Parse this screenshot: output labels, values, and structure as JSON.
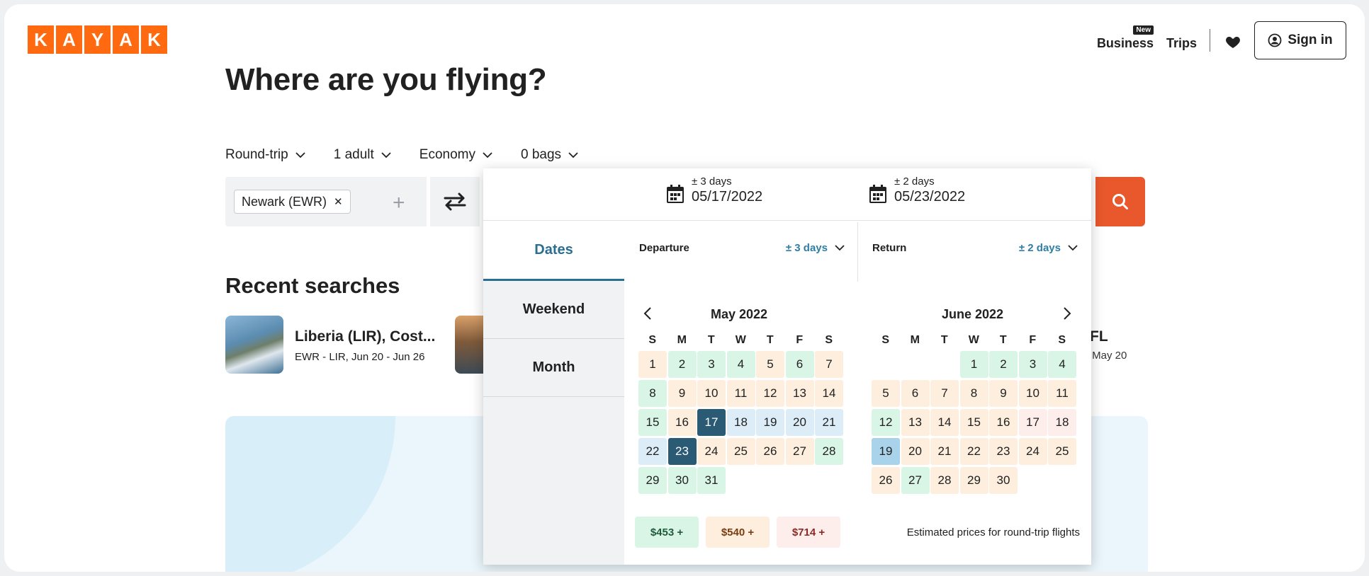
{
  "header": {
    "logo_letters": [
      "K",
      "A",
      "Y",
      "A",
      "K"
    ],
    "business": "Business",
    "new_badge": "New",
    "trips": "Trips",
    "signin": "Sign in"
  },
  "title": "Where are you flying?",
  "options": [
    "Round-trip",
    "1 adult",
    "Economy",
    "0 bags"
  ],
  "origin_chip": "Newark (EWR)",
  "origin_remove": "✕",
  "plus": "+",
  "recent": {
    "heading": "Recent searches",
    "item1_title": "Liberia (LIR), Cost...",
    "item1_sub": "EWR - LIR, Jun 20 - Jun 26",
    "item3_title": "FL",
    "item3_sub": "- May 20"
  },
  "picker": {
    "depart_flex": "± 3 days",
    "depart_date": "05/17/2022",
    "return_flex": "± 2 days",
    "return_date": "05/23/2022",
    "tabs": [
      "Dates",
      "Weekend",
      "Month"
    ],
    "departure_label": "Departure",
    "departure_flex": "± 3 days",
    "return_label": "Return",
    "return_flex2": "± 2 days",
    "dow": [
      "S",
      "M",
      "T",
      "W",
      "T",
      "F",
      "S"
    ],
    "may_title": "May 2022",
    "june_title": "June 2022",
    "may_days": [
      [
        "1",
        "o"
      ],
      [
        "2",
        "g"
      ],
      [
        "3",
        "g"
      ],
      [
        "4",
        "g"
      ],
      [
        "5",
        "o"
      ],
      [
        "6",
        "g"
      ],
      [
        "7",
        "o"
      ],
      [
        "8",
        "g"
      ],
      [
        "9",
        "o"
      ],
      [
        "10",
        "o"
      ],
      [
        "11",
        "o"
      ],
      [
        "12",
        "o"
      ],
      [
        "13",
        "o"
      ],
      [
        "14",
        "o"
      ],
      [
        "15",
        "g"
      ],
      [
        "16",
        "o"
      ],
      [
        "17",
        "sel"
      ],
      [
        "18",
        "b"
      ],
      [
        "19",
        "b"
      ],
      [
        "20",
        "b"
      ],
      [
        "21",
        "b"
      ],
      [
        "22",
        "b"
      ],
      [
        "23",
        "sel"
      ],
      [
        "24",
        "o"
      ],
      [
        "25",
        "o"
      ],
      [
        "26",
        "o"
      ],
      [
        "27",
        "o"
      ],
      [
        "28",
        "g"
      ],
      [
        "29",
        "g"
      ],
      [
        "30",
        "g"
      ],
      [
        "31",
        "g"
      ]
    ],
    "june_days": [
      [
        "",
        "e"
      ],
      [
        "",
        "e"
      ],
      [
        "",
        "e"
      ],
      [
        "1",
        "g"
      ],
      [
        "2",
        "g"
      ],
      [
        "3",
        "g"
      ],
      [
        "4",
        "g"
      ],
      [
        "5",
        "o"
      ],
      [
        "6",
        "o"
      ],
      [
        "7",
        "o"
      ],
      [
        "8",
        "o"
      ],
      [
        "9",
        "o"
      ],
      [
        "10",
        "o"
      ],
      [
        "11",
        "o"
      ],
      [
        "12",
        "g"
      ],
      [
        "13",
        "o"
      ],
      [
        "14",
        "o"
      ],
      [
        "15",
        "o"
      ],
      [
        "16",
        "o"
      ],
      [
        "17",
        "r"
      ],
      [
        "18",
        "r"
      ],
      [
        "19",
        "lb"
      ],
      [
        "20",
        "o"
      ],
      [
        "21",
        "o"
      ],
      [
        "22",
        "o"
      ],
      [
        "23",
        "o"
      ],
      [
        "24",
        "o"
      ],
      [
        "25",
        "o"
      ],
      [
        "26",
        "o"
      ],
      [
        "27",
        "g"
      ],
      [
        "28",
        "o"
      ],
      [
        "29",
        "o"
      ],
      [
        "30",
        "o"
      ]
    ],
    "legend": [
      {
        "label": "$453 +",
        "color": "#d9f5e6",
        "text": "#1f5c3b"
      },
      {
        "label": "$540 +",
        "color": "#fdeede",
        "text": "#7a3d12"
      },
      {
        "label": "$714 +",
        "color": "#fdeeec",
        "text": "#8a2a22"
      }
    ],
    "estimate_note": "Estimated prices for round-trip flights"
  },
  "colors": {
    "brand": "#ff690f",
    "search": "#e8582c",
    "accent": "#2b6e93",
    "selected": "#2a5a74"
  }
}
